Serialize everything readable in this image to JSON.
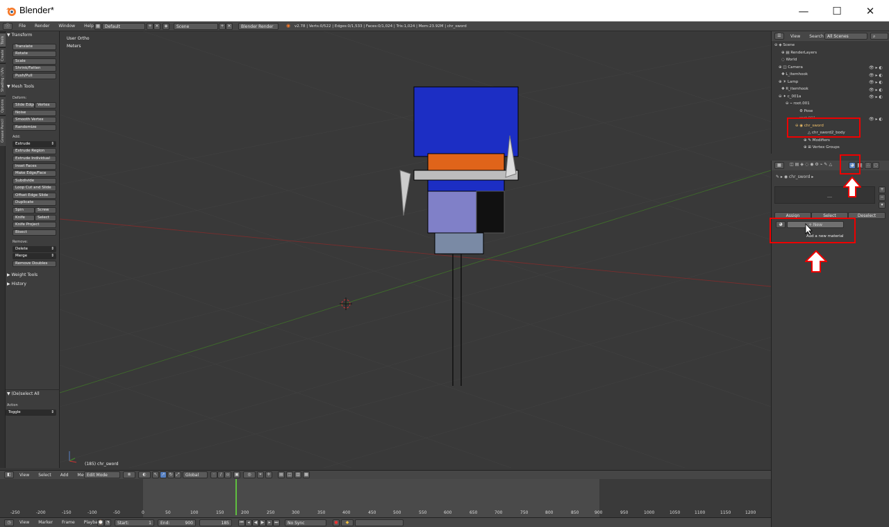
{
  "window": {
    "title": "Blender*",
    "minimize": "—",
    "maximize": "☐",
    "close": "✕"
  },
  "info": {
    "menus": [
      "File",
      "Render",
      "Window",
      "Help"
    ],
    "layout": "Default",
    "scene": "Scene",
    "engine": "Blender Render",
    "stats": "v2.78 | Verts:0/522 | Edges:0/1,533 | Faces:0/1,024 | Tris:1,024 | Mem:23.92M | chr_sword"
  },
  "tabs": [
    "Tools",
    "Create",
    "Shading / UVs",
    "Options",
    "Grease Pencil"
  ],
  "toolshelf": {
    "transform": {
      "header": "Transform",
      "buttons": [
        "Translate",
        "Rotate",
        "Scale",
        "Shrink/Fatten",
        "Push/Pull"
      ]
    },
    "mesh": {
      "header": "Mesh Tools",
      "deform_label": "Deform:",
      "slide_edge": "Slide Edge",
      "vertex": "Vertex",
      "noise": "Noise",
      "smooth": "Smooth Vertex",
      "randomize": "Randomize",
      "add_label": "Add:",
      "extrude": "Extrude",
      "extrude_region": "Extrude Region",
      "extrude_individual": "Extrude Individual",
      "inset": "Inset Faces",
      "make_edge": "Make Edge/Face",
      "subdivide": "Subdivide",
      "loopcut": "Loop Cut and Slide",
      "offset": "Offset Edge Slide",
      "duplicate": "Duplicate",
      "spin": "Spin",
      "screw": "Screw",
      "knife": "Knife",
      "select": "Select",
      "knife_project": "Knife Project",
      "bisect": "Bisect",
      "remove_label": "Remove:",
      "delete": "Delete",
      "merge": "Merge",
      "remove_doubles": "Remove Doubles"
    },
    "weight": "Weight Tools",
    "history": "History",
    "op": {
      "header": "(De)select All",
      "action_label": "Action",
      "action": "Toggle"
    }
  },
  "viewport": {
    "view": "User Ortho",
    "units": "Meters",
    "object": "(185) chr_sword"
  },
  "vphdr": {
    "menus": [
      "View",
      "Select",
      "Add",
      "Mesh"
    ],
    "mode": "Edit Mode",
    "orientation": "Global"
  },
  "timeline": {
    "ticks": [
      "-250",
      "-200",
      "-150",
      "-100",
      "-50",
      "0",
      "50",
      "100",
      "150",
      "200",
      "250",
      "300",
      "350",
      "400",
      "450",
      "500",
      "550",
      "600",
      "650",
      "700",
      "750",
      "800",
      "850",
      "900",
      "950",
      "1000",
      "1050",
      "1100",
      "1150",
      "1200"
    ],
    "current": 185,
    "start": 1,
    "end": 900
  },
  "tlhdr": {
    "menus": [
      "View",
      "Marker",
      "Frame",
      "Playback"
    ],
    "start": "Start:",
    "start_val": "1",
    "end": "End:",
    "end_val": "900",
    "current": "185",
    "sync": "No Sync"
  },
  "outliner": {
    "menus": [
      "View",
      "Search"
    ],
    "filter": "All Scenes",
    "rows": [
      "Scene",
      "RenderLayers",
      "World",
      "Camera",
      "L_itemhook",
      "Lamp",
      "R_itemhook",
      "c_001a",
      "root.001",
      "Pose",
      "root.001",
      "chr_sword",
      "chr_sword2_body",
      "Modifiers",
      "Vertex Groups"
    ]
  },
  "props": {
    "object": "chr_sword",
    "assign": "Assign",
    "select": "Select",
    "deselect": "Deselect",
    "new": "New",
    "tooltip": "Add a new material"
  },
  "colors": {
    "highlight": "#ee0000",
    "accent": "#5680c2",
    "selected": "#f39c3c"
  }
}
